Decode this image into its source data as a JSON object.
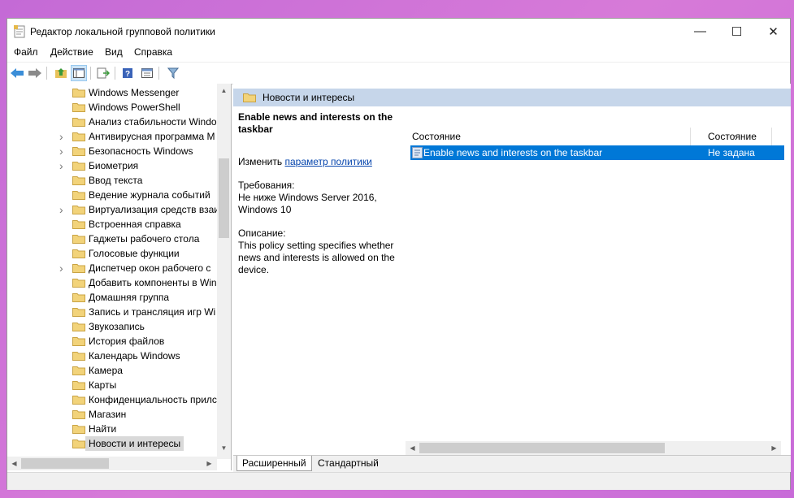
{
  "window": {
    "title": "Редактор локальной групповой политики",
    "controls": {
      "minimize": "—",
      "maximize": "☐",
      "close": "✕"
    }
  },
  "menu": [
    "Файл",
    "Действие",
    "Вид",
    "Справка"
  ],
  "toolbar": {
    "icons": [
      "back-arrow-icon",
      "forward-arrow-icon",
      "up-folder-icon",
      "show-hide-tree-icon",
      "export-list-icon",
      "help-icon",
      "properties-icon",
      "filter-icon"
    ]
  },
  "tree": {
    "items": [
      {
        "label": "Windows Messenger",
        "expandable": false
      },
      {
        "label": "Windows PowerShell",
        "expandable": false
      },
      {
        "label": "Анализ стабильности Windo",
        "expandable": false
      },
      {
        "label": "Антивирусная программа M",
        "expandable": true
      },
      {
        "label": "Безопасность Windows",
        "expandable": true
      },
      {
        "label": "Биометрия",
        "expandable": true
      },
      {
        "label": "Ввод текста",
        "expandable": false
      },
      {
        "label": "Ведение журнала событий",
        "expandable": false
      },
      {
        "label": "Виртуализация средств взаи",
        "expandable": true
      },
      {
        "label": "Встроенная справка",
        "expandable": false
      },
      {
        "label": "Гаджеты рабочего стола",
        "expandable": false
      },
      {
        "label": "Голосовые функции",
        "expandable": false
      },
      {
        "label": "Диспетчер окон рабочего с",
        "expandable": true
      },
      {
        "label": "Добавить компоненты в Win",
        "expandable": false
      },
      {
        "label": "Домашняя группа",
        "expandable": false
      },
      {
        "label": "Запись и трансляция игр Wi",
        "expandable": false
      },
      {
        "label": "Звукозапись",
        "expandable": false
      },
      {
        "label": "История файлов",
        "expandable": false
      },
      {
        "label": "Календарь Windows",
        "expandable": false
      },
      {
        "label": "Камера",
        "expandable": false
      },
      {
        "label": "Карты",
        "expandable": false
      },
      {
        "label": "Конфиденциальность прилс",
        "expandable": false
      },
      {
        "label": "Магазин",
        "expandable": false
      },
      {
        "label": "Найти",
        "expandable": false
      },
      {
        "label": "Новости и интересы",
        "expandable": false,
        "selected": true
      }
    ]
  },
  "right": {
    "header": "Новости и интересы",
    "extended": {
      "title": "Enable news and interests on the taskbar",
      "edit_prefix": "Изменить",
      "edit_link": "параметр политики",
      "requirements_label": "Требования:",
      "requirements": "Не ниже Windows Server 2016, Windows 10",
      "description_label": "Описание:",
      "description": "This policy setting specifies whether news and interests is allowed on the device."
    },
    "columns": [
      "Состояние",
      "Состояние"
    ],
    "rows": [
      {
        "name": "Enable news and interests on the taskbar",
        "state": "Не задана"
      }
    ]
  },
  "tabs": [
    "Расширенный",
    "Стандартный"
  ]
}
